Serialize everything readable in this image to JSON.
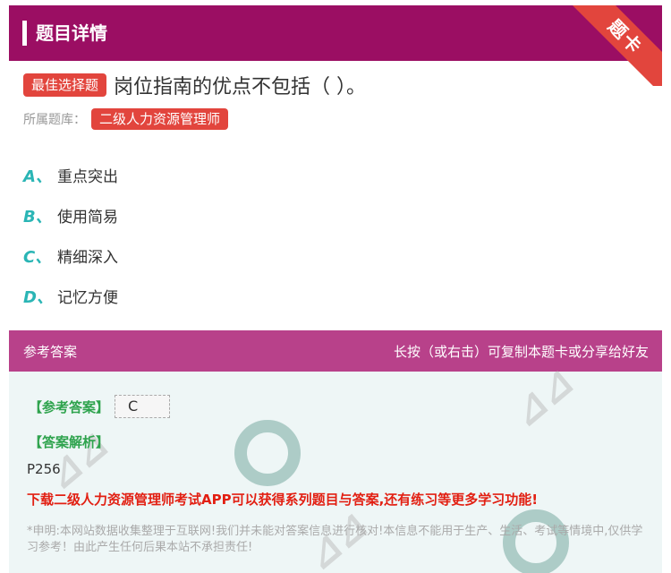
{
  "header": {
    "title": "题目详情",
    "ribbon_label": "题卡"
  },
  "question": {
    "type_badge": "最佳选择题",
    "text": "岗位指南的优点不包括（          ）。",
    "bank_label": "所属题库：",
    "bank_name": "二级人力资源管理师"
  },
  "options": [
    {
      "letter": "A、",
      "text": "重点突出"
    },
    {
      "letter": "B、",
      "text": "使用简易"
    },
    {
      "letter": "C、",
      "text": "精细深入"
    },
    {
      "letter": "D、",
      "text": "记忆方便"
    }
  ],
  "answer": {
    "heading": "参考答案",
    "share_hint": "长按（或右击）可复制本题卡或分享给好友",
    "ref_label": "【参考答案】",
    "ref_value": "C",
    "analysis_label": "【答案解析】",
    "analysis_text": "P256",
    "promo": "下载二级人力资源管理师考试APP可以获得系列题目与答案,还有练习等更多学习功能!",
    "disclaimer": "*申明:本网站数据收集整理于互联网!我们并未能对答案信息进行核对!本信息不能用于生产、生活、考试等情境中,仅供学习参考！由此产生任何后果本站不承担责任!"
  },
  "colors": {
    "header_bg": "#9b0e63",
    "badge_bg": "#e2453d",
    "option_letter": "#2ab5b5",
    "answer_head_bg": "#b8418a",
    "answer_label": "#2ea34d",
    "promo": "#e21f12"
  }
}
